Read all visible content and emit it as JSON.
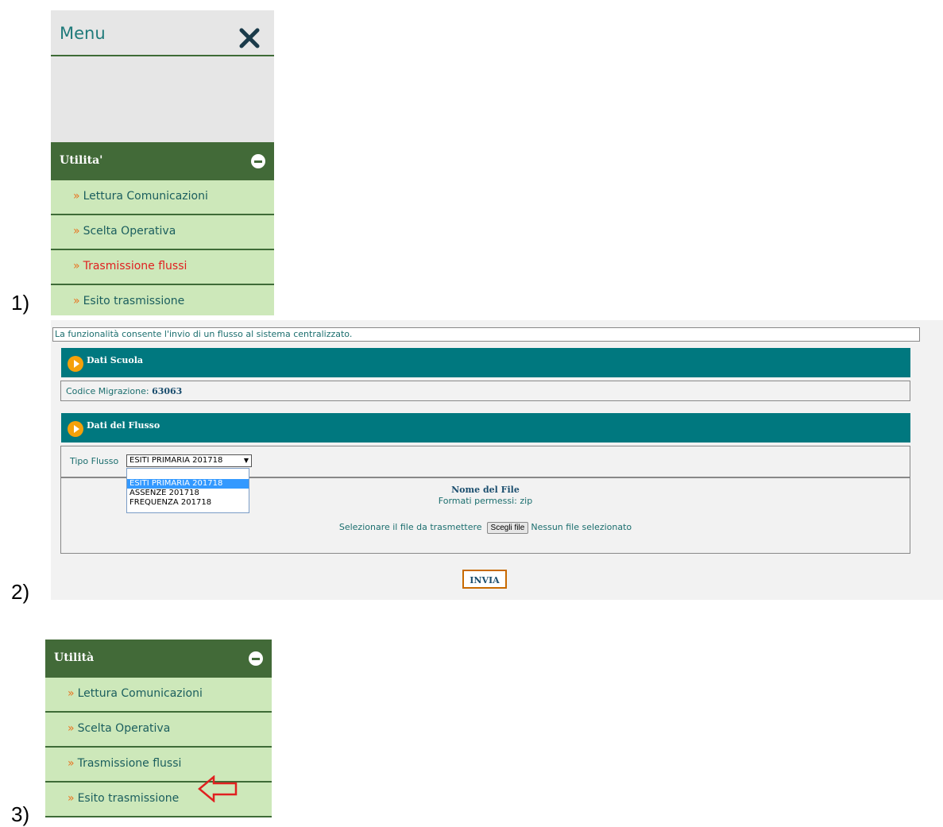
{
  "steps": [
    "1)",
    "2)",
    "3)"
  ],
  "panel1": {
    "menu_title": "Menu",
    "section_label": "Utilita'",
    "items": [
      {
        "label": "Lettura Comunicazioni",
        "active": false
      },
      {
        "label": "Scelta Operativa",
        "active": false
      },
      {
        "label": "Trasmissione flussi",
        "active": true
      },
      {
        "label": "Esito trasmissione",
        "active": false
      }
    ]
  },
  "panel2": {
    "info": "La funzionalità consente l'invio di un flusso al sistema centralizzato.",
    "dati_scuola": "Dati Scuola",
    "codice_label": "Codice Migrazione:",
    "codice_value": "63063",
    "dati_flusso": "Dati del Flusso",
    "tipo_label": "Tipo Flusso",
    "tipo_selected": "ESITI PRIMARIA 201718",
    "tipo_options": [
      "ESITI PRIMARIA 201718",
      "ASSENZE 201718",
      "FREQUENZA 201718"
    ],
    "file_title": "Nome del File",
    "file_formats": "Formati permessi: zip",
    "select_file_label": "Selezionare il file da trasmettere",
    "choose_button": "Scegli file",
    "no_file": "Nessun file selezionato",
    "submit": "INVIA"
  },
  "panel3": {
    "section_label": "Utilità",
    "items": [
      {
        "label": "Lettura Comunicazioni"
      },
      {
        "label": "Scelta Operativa"
      },
      {
        "label": "Trasmissione flussi"
      },
      {
        "label": "Esito trasmissione"
      }
    ]
  },
  "colors": {
    "menu_green": "#426a38",
    "item_bg": "#cde8ba",
    "teal": "#00787f",
    "active_red": "#e02020",
    "annotation_red": "#e02020"
  },
  "icons": {
    "close": "close-icon",
    "toggle": "minus-circle-icon",
    "section": "play-circle-icon",
    "annotation": "left-arrow-icon"
  }
}
